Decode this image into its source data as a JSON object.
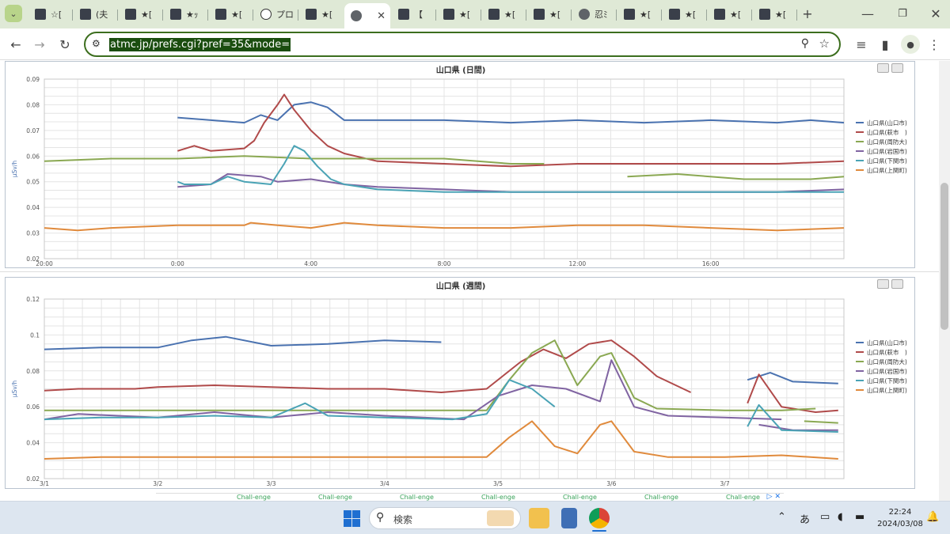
{
  "browser": {
    "tabs": [
      {
        "label": "☆[",
        "icon": "site-icon"
      },
      {
        "label": "(夫",
        "icon": "site-icon"
      },
      {
        "label": "★[",
        "icon": "site-icon"
      },
      {
        "label": "★ｯ",
        "icon": "site-icon"
      },
      {
        "label": "★[",
        "icon": "site-icon"
      },
      {
        "label": "プロ",
        "icon": "info-icon"
      },
      {
        "label": "★[",
        "icon": "site-icon"
      },
      {
        "label": "",
        "icon": "globe-icon",
        "active": true
      },
      {
        "label": "【",
        "icon": "site-icon"
      },
      {
        "label": "★[",
        "icon": "site-icon"
      },
      {
        "label": "★[",
        "icon": "site-icon"
      },
      {
        "label": "★[",
        "icon": "site-icon"
      },
      {
        "label": "忍ﾐ",
        "icon": "globe-icon"
      },
      {
        "label": "★[",
        "icon": "site-icon"
      },
      {
        "label": "★[",
        "icon": "site-icon"
      },
      {
        "label": "★[",
        "icon": "site-icon"
      },
      {
        "label": "★[",
        "icon": "site-icon"
      }
    ],
    "new_tab": "+",
    "url": "atmc.jp/prefs.cgi?pref=35&mode="
  },
  "charts": {
    "daily": {
      "title": "山口県 (日間)",
      "ylabel": "μSv/h",
      "yticks": [
        "0.09",
        "0.08",
        "0.07",
        "0.06",
        "0.05",
        "0.04",
        "0.03",
        "0.02"
      ],
      "xticks": [
        "20:00",
        "0:00",
        "4:00",
        "8:00",
        "12:00",
        "16:00"
      ],
      "legend": [
        "山口県(山口市)",
        "山口県(萩市　)",
        "山口県(周防大)",
        "山口県(岩国市)",
        "山口県(下関市)",
        "山口県(上関町)"
      ]
    },
    "weekly": {
      "title": "山口県 (週間)",
      "ylabel": "μSv/h",
      "yticks": [
        "0.12",
        "0.1",
        "0.08",
        "0.06",
        "0.04",
        "0.02"
      ],
      "xticks": [
        "3/1",
        "3/2",
        "3/3",
        "3/4",
        "3/5",
        "3/6",
        "3/7"
      ],
      "legend": [
        "山口県(山口市)",
        "山口県(萩市　)",
        "山口県(周防大)",
        "山口県(岩国市)",
        "山口県(下関市)",
        "山口県(上関町)"
      ]
    }
  },
  "chart_data": [
    {
      "type": "line",
      "title": "山口県 (日間)",
      "ylabel": "μSv/h",
      "ylim": [
        0.02,
        0.09
      ],
      "x_hours": [
        0,
        1,
        2,
        3,
        4,
        5,
        6,
        7,
        8,
        9,
        10,
        11,
        12,
        13,
        14,
        15,
        16,
        17,
        18,
        19,
        20
      ],
      "x_note_label_start": "20:00 previous day at x=-4",
      "series": [
        {
          "name": "山口県(山口市)",
          "color": "#4a72b0",
          "points": [
            [
              0,
              0.075
            ],
            [
              1,
              0.074
            ],
            [
              2,
              0.073
            ],
            [
              2.5,
              0.076
            ],
            [
              3,
              0.074
            ],
            [
              3.5,
              0.08
            ],
            [
              4,
              0.081
            ],
            [
              4.5,
              0.079
            ],
            [
              5,
              0.074
            ],
            [
              6,
              0.074
            ],
            [
              8,
              0.074
            ],
            [
              10,
              0.073
            ],
            [
              12,
              0.074
            ],
            [
              14,
              0.073
            ],
            [
              16,
              0.074
            ],
            [
              18,
              0.073
            ],
            [
              19,
              0.074
            ],
            [
              20,
              0.073
            ]
          ]
        },
        {
          "name": "山口県(萩市　)",
          "color": "#b04a4a",
          "points": [
            [
              0,
              0.062
            ],
            [
              0.5,
              0.064
            ],
            [
              1,
              0.062
            ],
            [
              2,
              0.063
            ],
            [
              2.3,
              0.066
            ],
            [
              2.6,
              0.073
            ],
            [
              3,
              0.08
            ],
            [
              3.2,
              0.084
            ],
            [
              3.5,
              0.078
            ],
            [
              4,
              0.07
            ],
            [
              4.5,
              0.064
            ],
            [
              5,
              0.061
            ],
            [
              6,
              0.058
            ],
            [
              8,
              0.057
            ],
            [
              10,
              0.056
            ],
            [
              12,
              0.057
            ],
            [
              14,
              0.057
            ],
            [
              16,
              0.057
            ],
            [
              18,
              0.057
            ],
            [
              20,
              0.058
            ]
          ]
        },
        {
          "name": "山口県(周防大)",
          "color": "#8aa852",
          "points": [
            [
              -4,
              0.058
            ],
            [
              -2,
              0.059
            ],
            [
              0,
              0.059
            ],
            [
              2,
              0.06
            ],
            [
              4,
              0.059
            ],
            [
              6,
              0.059
            ],
            [
              8,
              0.059
            ],
            [
              10,
              0.057
            ],
            [
              11,
              0.057
            ]
          ],
          "points2": [
            [
              13.5,
              0.052
            ],
            [
              15,
              0.053
            ],
            [
              17,
              0.051
            ],
            [
              19,
              0.051
            ],
            [
              20,
              0.052
            ]
          ]
        },
        {
          "name": "山口県(岩国市)",
          "color": "#8064a2",
          "points": [
            [
              0,
              0.048
            ],
            [
              1,
              0.049
            ],
            [
              1.5,
              0.053
            ],
            [
              2.5,
              0.052
            ],
            [
              3,
              0.05
            ],
            [
              4,
              0.051
            ],
            [
              5,
              0.049
            ],
            [
              6,
              0.048
            ],
            [
              8,
              0.047
            ],
            [
              10,
              0.046
            ],
            [
              12,
              0.046
            ],
            [
              14,
              0.046
            ],
            [
              16,
              0.046
            ],
            [
              18,
              0.046
            ],
            [
              20,
              0.047
            ]
          ]
        },
        {
          "name": "山口県(下関市)",
          "color": "#4aa3b5",
          "points": [
            [
              0,
              0.05
            ],
            [
              0.2,
              0.049
            ],
            [
              1,
              0.049
            ],
            [
              1.5,
              0.052
            ],
            [
              2,
              0.05
            ],
            [
              2.8,
              0.049
            ],
            [
              3.2,
              0.057
            ],
            [
              3.5,
              0.064
            ],
            [
              3.8,
              0.062
            ],
            [
              4.2,
              0.056
            ],
            [
              4.6,
              0.051
            ],
            [
              5,
              0.049
            ],
            [
              6,
              0.047
            ],
            [
              8,
              0.046
            ],
            [
              10,
              0.046
            ],
            [
              12,
              0.046
            ],
            [
              14,
              0.046
            ],
            [
              16,
              0.046
            ],
            [
              18,
              0.046
            ],
            [
              20,
              0.046
            ]
          ]
        },
        {
          "name": "山口県(上関町)",
          "color": "#e08a3c",
          "points": [
            [
              -4,
              0.032
            ],
            [
              -3,
              0.031
            ],
            [
              -2,
              0.032
            ],
            [
              0,
              0.033
            ],
            [
              2,
              0.033
            ],
            [
              2.2,
              0.034
            ],
            [
              3,
              0.033
            ],
            [
              4,
              0.032
            ],
            [
              5,
              0.034
            ],
            [
              6,
              0.033
            ],
            [
              8,
              0.032
            ],
            [
              10,
              0.032
            ],
            [
              12,
              0.033
            ],
            [
              14,
              0.033
            ],
            [
              16,
              0.032
            ],
            [
              18,
              0.031
            ],
            [
              20,
              0.032
            ]
          ]
        }
      ]
    },
    {
      "type": "line",
      "title": "山口県 (週間)",
      "ylabel": "μSv/h",
      "ylim": [
        0.02,
        0.12
      ],
      "categories": [
        "3/1",
        "3/2",
        "3/3",
        "3/4",
        "3/5",
        "3/6",
        "3/7"
      ],
      "x_days": [
        0,
        1,
        2,
        3,
        4,
        5,
        6,
        7
      ],
      "series": [
        {
          "name": "山口県(山口市)",
          "color": "#4a72b0",
          "points": [
            [
              0,
              0.092
            ],
            [
              0.5,
              0.093
            ],
            [
              1,
              0.093
            ],
            [
              1.3,
              0.097
            ],
            [
              1.6,
              0.099
            ],
            [
              2,
              0.094
            ],
            [
              2.5,
              0.095
            ],
            [
              3,
              0.097
            ],
            [
              3.5,
              0.096
            ]
          ],
          "points2": [
            [
              6.2,
              0.075
            ],
            [
              6.4,
              0.079
            ],
            [
              6.6,
              0.074
            ],
            [
              7,
              0.073
            ]
          ]
        },
        {
          "name": "山口県(萩市　)",
          "color": "#b04a4a",
          "points": [
            [
              0,
              0.069
            ],
            [
              0.3,
              0.07
            ],
            [
              0.8,
              0.07
            ],
            [
              1,
              0.071
            ],
            [
              1.5,
              0.072
            ],
            [
              2,
              0.071
            ],
            [
              2.5,
              0.07
            ],
            [
              3,
              0.07
            ],
            [
              3.5,
              0.068
            ],
            [
              3.9,
              0.07
            ],
            [
              4.2,
              0.085
            ],
            [
              4.4,
              0.092
            ],
            [
              4.6,
              0.087
            ],
            [
              4.8,
              0.095
            ],
            [
              5,
              0.097
            ],
            [
              5.2,
              0.088
            ],
            [
              5.4,
              0.077
            ],
            [
              5.7,
              0.068
            ]
          ],
          "points2": [
            [
              6.2,
              0.062
            ],
            [
              6.3,
              0.078
            ],
            [
              6.5,
              0.06
            ],
            [
              6.8,
              0.057
            ],
            [
              7,
              0.058
            ]
          ]
        },
        {
          "name": "山口県(周防大)",
          "color": "#8aa852",
          "points": [
            [
              0,
              0.058
            ],
            [
              1,
              0.058
            ],
            [
              2,
              0.058
            ],
            [
              3,
              0.058
            ],
            [
              3.9,
              0.058
            ],
            [
              4.1,
              0.075
            ],
            [
              4.3,
              0.09
            ],
            [
              4.5,
              0.097
            ],
            [
              4.7,
              0.072
            ],
            [
              4.9,
              0.088
            ],
            [
              5,
              0.09
            ],
            [
              5.2,
              0.065
            ],
            [
              5.4,
              0.059
            ],
            [
              6,
              0.058
            ],
            [
              6.5,
              0.058
            ],
            [
              6.8,
              0.059
            ]
          ],
          "points2": [
            [
              6.7,
              0.052
            ],
            [
              7,
              0.051
            ]
          ]
        },
        {
          "name": "山口県(岩国市)",
          "color": "#8064a2",
          "points": [
            [
              0,
              0.053
            ],
            [
              0.3,
              0.056
            ],
            [
              1,
              0.054
            ],
            [
              1.5,
              0.057
            ],
            [
              2,
              0.054
            ],
            [
              2.5,
              0.057
            ],
            [
              3,
              0.055
            ],
            [
              3.7,
              0.053
            ],
            [
              4,
              0.066
            ],
            [
              4.3,
              0.072
            ],
            [
              4.6,
              0.07
            ],
            [
              4.9,
              0.063
            ],
            [
              5,
              0.086
            ],
            [
              5.2,
              0.06
            ],
            [
              5.5,
              0.055
            ],
            [
              6,
              0.054
            ],
            [
              6.5,
              0.053
            ]
          ],
          "points2": [
            [
              6.3,
              0.05
            ],
            [
              6.6,
              0.047
            ],
            [
              7,
              0.047
            ]
          ]
        },
        {
          "name": "山口県(下関市)",
          "color": "#4aa3b5",
          "points": [
            [
              0,
              0.053
            ],
            [
              0.5,
              0.054
            ],
            [
              1,
              0.054
            ],
            [
              1.5,
              0.055
            ],
            [
              2,
              0.054
            ],
            [
              2.3,
              0.062
            ],
            [
              2.5,
              0.055
            ],
            [
              3,
              0.054
            ],
            [
              3.6,
              0.053
            ],
            [
              3.9,
              0.056
            ],
            [
              4.1,
              0.075
            ],
            [
              4.3,
              0.07
            ],
            [
              4.5,
              0.06
            ]
          ],
          "points2": [
            [
              6.2,
              0.049
            ],
            [
              6.3,
              0.061
            ],
            [
              6.5,
              0.047
            ],
            [
              7,
              0.046
            ]
          ]
        },
        {
          "name": "山口県(上関町)",
          "color": "#e08a3c",
          "points": [
            [
              0,
              0.031
            ],
            [
              0.5,
              0.032
            ],
            [
              1,
              0.032
            ],
            [
              2,
              0.032
            ],
            [
              3,
              0.032
            ],
            [
              3.9,
              0.032
            ],
            [
              4.1,
              0.043
            ],
            [
              4.3,
              0.052
            ],
            [
              4.5,
              0.038
            ],
            [
              4.7,
              0.034
            ],
            [
              4.9,
              0.05
            ],
            [
              5,
              0.052
            ],
            [
              5.2,
              0.035
            ],
            [
              5.5,
              0.032
            ],
            [
              6,
              0.032
            ],
            [
              6.5,
              0.033
            ],
            [
              7,
              0.031
            ]
          ]
        }
      ]
    }
  ],
  "ad": {
    "items": [
      "Chall-enge",
      "Chall-enge",
      "Chall-enge",
      "Chall-enge",
      "Chall-enge",
      "Chall-enge",
      "Chall-enge"
    ]
  },
  "taskbar": {
    "search_placeholder": "検索",
    "ime": "あ",
    "time": "22:24",
    "date": "2024/03/08"
  }
}
